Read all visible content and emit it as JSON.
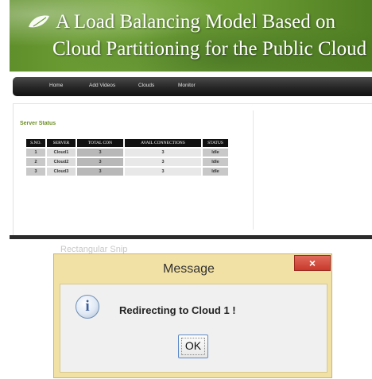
{
  "banner": {
    "line1": "A Load Balancing Model Based on",
    "line2": "Cloud Partitioning for the Public Cloud"
  },
  "nav": {
    "items": [
      "Home",
      "Add Videos",
      "Clouds",
      "Monitor"
    ]
  },
  "server_status": {
    "title": "Server Status",
    "columns": [
      "S.NO.",
      "SERVER",
      "TOTAL CON",
      "AVAIL CONNECTIONS",
      "STATUS"
    ],
    "rows": [
      [
        "1",
        "Cloud1",
        "3",
        "3",
        "Idle"
      ],
      [
        "2",
        "Cloud2",
        "3",
        "3",
        "Idle"
      ],
      [
        "3",
        "Cloud3",
        "3",
        "3",
        "Idle"
      ]
    ]
  },
  "background_window": {
    "title": "Rectangular Snip"
  },
  "dialog": {
    "title": "Message",
    "close_label": "×",
    "message": "Redirecting to Cloud 1 !",
    "icon": "info-icon",
    "ok_label": "OK"
  },
  "colors": {
    "banner_green": "#6a9b33",
    "section_title": "#6b8e23",
    "dialog_frame": "#f2e1a4",
    "close_red": "#c7392b"
  }
}
